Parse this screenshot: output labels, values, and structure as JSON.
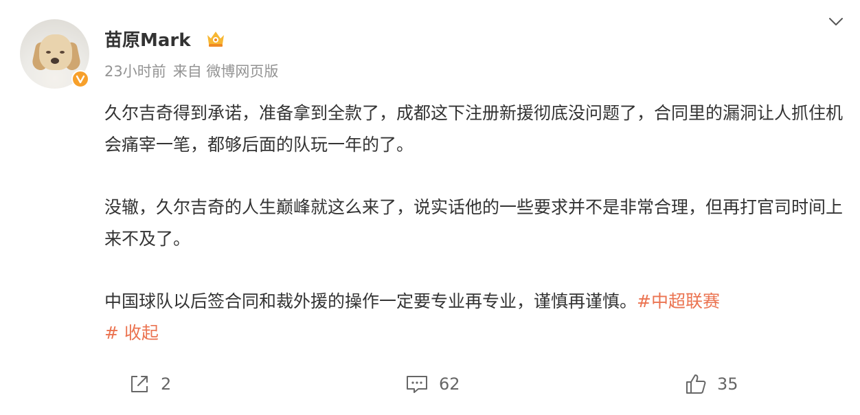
{
  "post": {
    "author": "苗原Mark",
    "time": "23小时前",
    "source": "来自 微博网页版",
    "paragraphs": [
      {
        "text": "久尔吉奇得到承诺，准备拿到全款了，成都这下注册新援彻底没问题了，合同里的漏洞让人抓住机会痛宰一笔，都够后面的队玩一年的了。"
      },
      {
        "text": "没辙，久尔吉奇的人生巅峰就这么来了，说实话他的一些要求并不是非常合理，但再打官司时间上来不及了。"
      },
      {
        "text": "中国球队以后签合同和裁外援的操作一定要专业再专业，谨慎再谨慎。",
        "hashtag": "#中超联赛",
        "fold": "# 收起"
      }
    ]
  },
  "actions": {
    "repost_count": "2",
    "comment_count": "62",
    "like_count": "35"
  },
  "colors": {
    "accent": "#eb7350",
    "meta": "#939393",
    "text": "#333333",
    "badge": "#f7a02b"
  },
  "icons": [
    "avatar-verified-badge",
    "vip-crown-icon",
    "chevron-down-icon",
    "repost-icon",
    "comment-icon",
    "like-icon"
  ]
}
